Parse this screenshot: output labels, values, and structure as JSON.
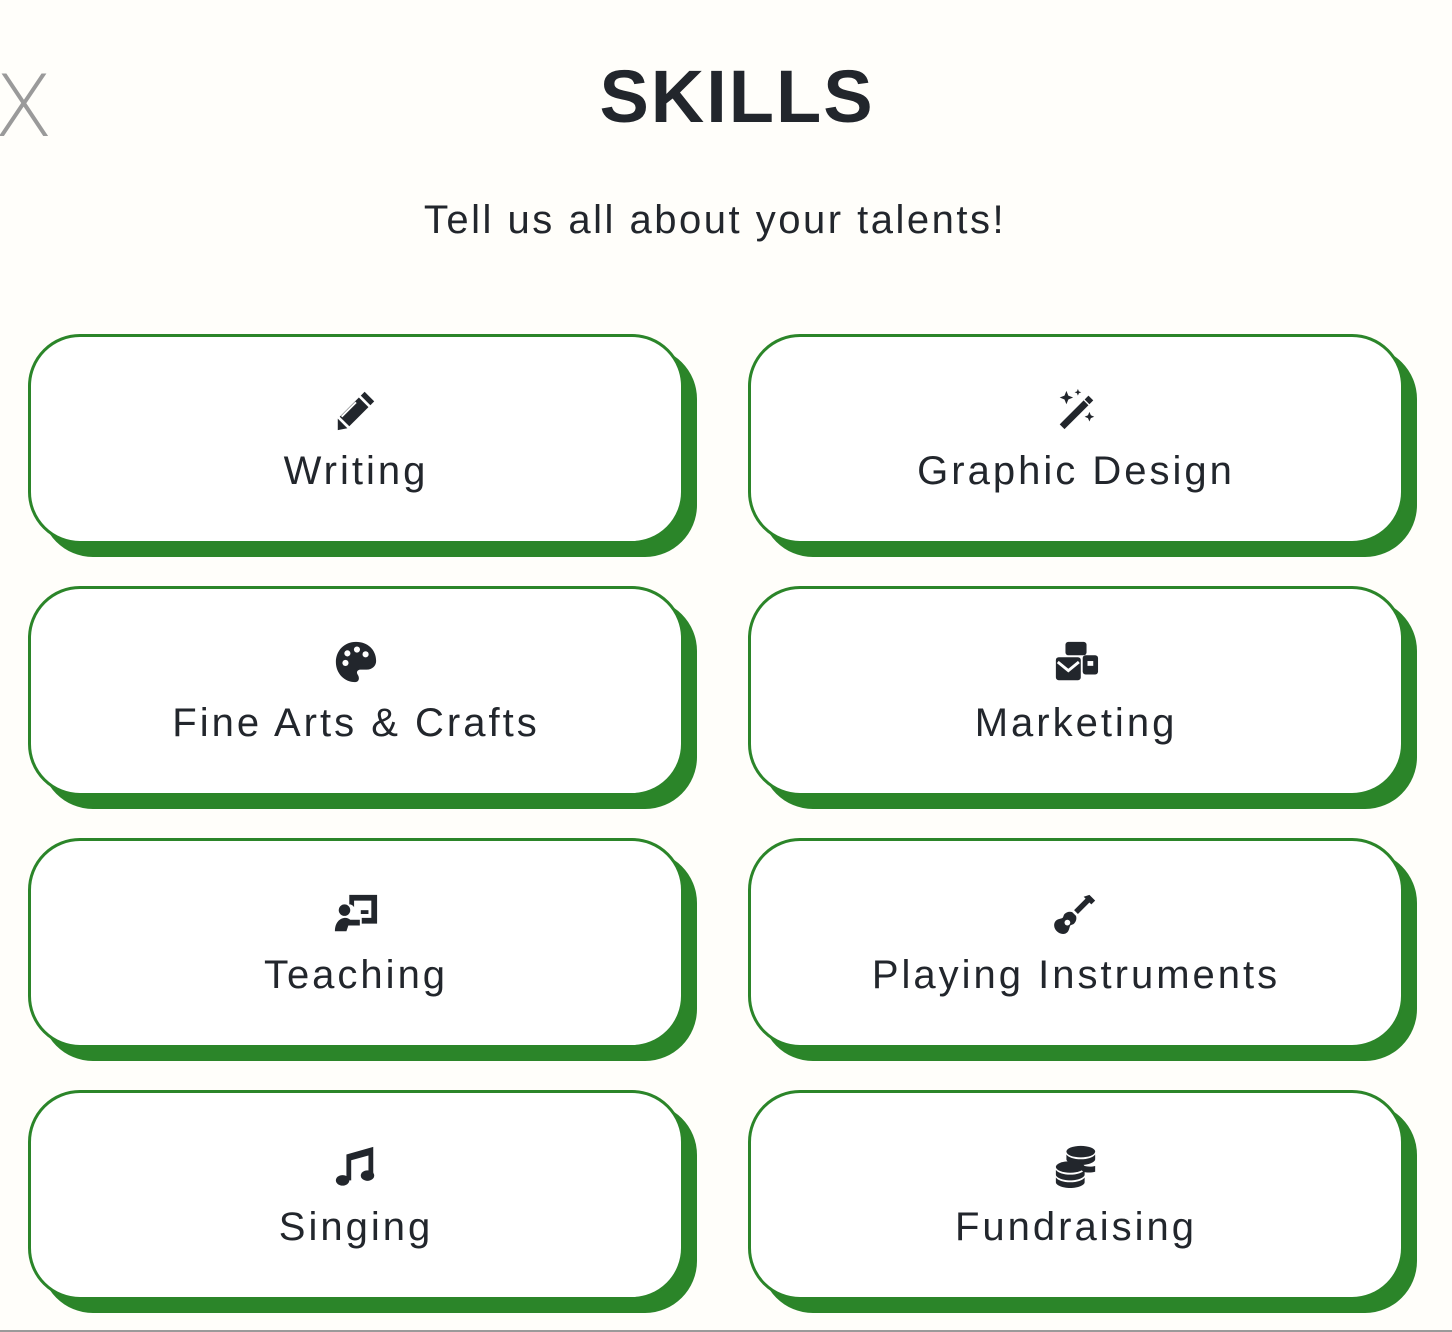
{
  "close": {
    "label": "X",
    "icon": "close-icon"
  },
  "header": {
    "title": "SKILLS",
    "subtitle": "Tell us all about your talents!"
  },
  "colors": {
    "accent": "#2b8529",
    "text": "#22262c",
    "background": "#fffefa",
    "card_background": "#ffffff"
  },
  "skills": [
    {
      "label": "Writing",
      "icon": "pencil-icon"
    },
    {
      "label": "Graphic Design",
      "icon": "magic-wand-icon"
    },
    {
      "label": "Fine Arts & Crafts",
      "icon": "palette-icon"
    },
    {
      "label": "Marketing",
      "icon": "mail-bulk-icon"
    },
    {
      "label": "Teaching",
      "icon": "teacher-board-icon"
    },
    {
      "label": "Playing Instruments",
      "icon": "guitar-icon"
    },
    {
      "label": "Singing",
      "icon": "music-note-icon"
    },
    {
      "label": "Fundraising",
      "icon": "coins-icon"
    }
  ]
}
